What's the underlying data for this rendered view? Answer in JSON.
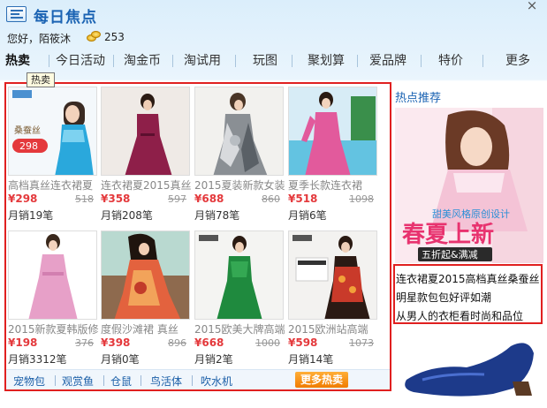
{
  "app": {
    "title": "每日焦点",
    "close_glyph": "×"
  },
  "user": {
    "greeting": "您好，陌筱沐",
    "coins": "253"
  },
  "nav": {
    "items": [
      "热卖",
      "今日活动",
      "淘金币",
      "淘试用",
      "玩图",
      "聚划算",
      "爱品牌",
      "特价",
      "更多"
    ],
    "tooltip": "热卖"
  },
  "products": [
    {
      "name": "高档真丝连衣裙夏",
      "price": "¥298",
      "old_price": "518",
      "sales": "月销19笔",
      "badge": "298"
    },
    {
      "name": "连衣裙夏2015真丝",
      "price": "¥358",
      "old_price": "597",
      "sales": "月销208笔"
    },
    {
      "name": "2015夏装新款女装",
      "price": "¥688",
      "old_price": "860",
      "sales": "月销78笔"
    },
    {
      "name": "夏季长款连衣裙",
      "price": "¥518",
      "old_price": "1098",
      "sales": "月销6笔"
    },
    {
      "name": "2015新款夏韩版修",
      "price": "¥198",
      "old_price": "376",
      "sales": "月销3312笔"
    },
    {
      "name": "度假沙滩裙 真丝",
      "price": "¥398",
      "old_price": "896",
      "sales": "月销0笔"
    },
    {
      "name": "2015欧美大牌高端",
      "price": "¥668",
      "old_price": "1000",
      "sales": "月销2笔"
    },
    {
      "name": "2015欧洲站高端",
      "price": "¥598",
      "old_price": "1073",
      "sales": "月销14笔"
    }
  ],
  "tags": [
    "宠物包",
    "观赏鱼",
    "仓鼠",
    "鸟活体",
    "吹水机"
  ],
  "more_button": "更多热卖",
  "hot": {
    "title": "热点推荐",
    "banner_text": "春夏上新",
    "banner_sub": "甜美风格原创设计",
    "banner_badge": "五折起&满减",
    "links": [
      "连衣裙夏2015高档真丝桑蚕丝",
      "明星款包包好评如潮",
      "从男人的衣柜看时尚和品位"
    ]
  },
  "colors": {
    "accent": "#1b63b3",
    "price_red": "#e4393c",
    "highlight_border": "#e02020"
  }
}
